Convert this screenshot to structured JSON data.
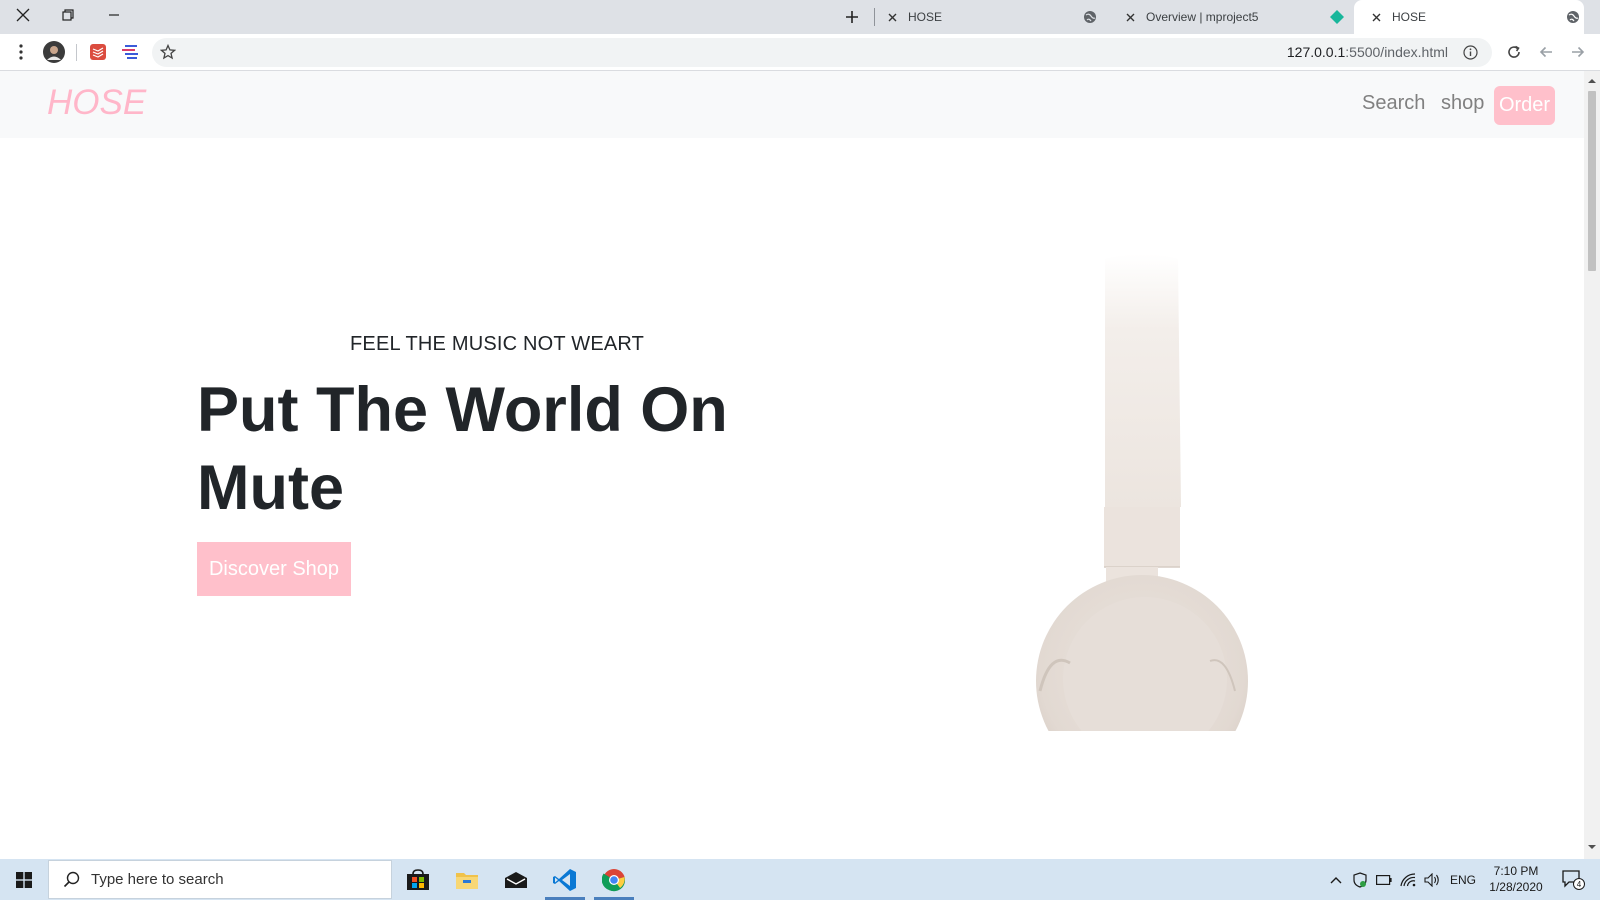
{
  "browser": {
    "tabs": [
      {
        "title": "HOSE",
        "active": false
      },
      {
        "title": "Overview | mproject5",
        "active": false
      },
      {
        "title": "HOSE",
        "active": true
      }
    ],
    "url": {
      "host": "127.0.0.1",
      "path": ":5500/index.html"
    }
  },
  "site": {
    "brand": "HOSE",
    "nav": {
      "search": "Search",
      "shop": "shop",
      "order": "Order"
    },
    "hero": {
      "tagline": "FEEL THE MUSIC NOT WEART",
      "headline": "Put The World On Mute",
      "cta": "Discover Shop"
    }
  },
  "taskbar": {
    "search_placeholder": "Type here to search",
    "language": "ENG",
    "time": "7:10 PM",
    "date": "1/28/2020",
    "notification_count": "4"
  },
  "colors": {
    "accent_pink": "#ffc0cb",
    "brand_pink": "#ffb6c9",
    "headline": "#212529",
    "navbar_bg": "#f8f9fa",
    "taskbar_bg": "#d5e4f2"
  },
  "icons": [
    "close-icon",
    "restore-icon",
    "minimize-icon",
    "new-tab-icon",
    "globe-icon",
    "diamond-icon",
    "menu-icon",
    "avatar",
    "todoist-icon",
    "extension-icon",
    "star-icon",
    "info-icon",
    "reload-icon",
    "back-icon",
    "forward-icon",
    "windows-icon",
    "search-icon",
    "store-icon",
    "folder-icon",
    "mail-icon",
    "vscode-icon",
    "chrome-icon",
    "chevron-up-icon",
    "defender-icon",
    "battery-icon",
    "wifi-icon",
    "volume-icon",
    "notification-icon"
  ]
}
